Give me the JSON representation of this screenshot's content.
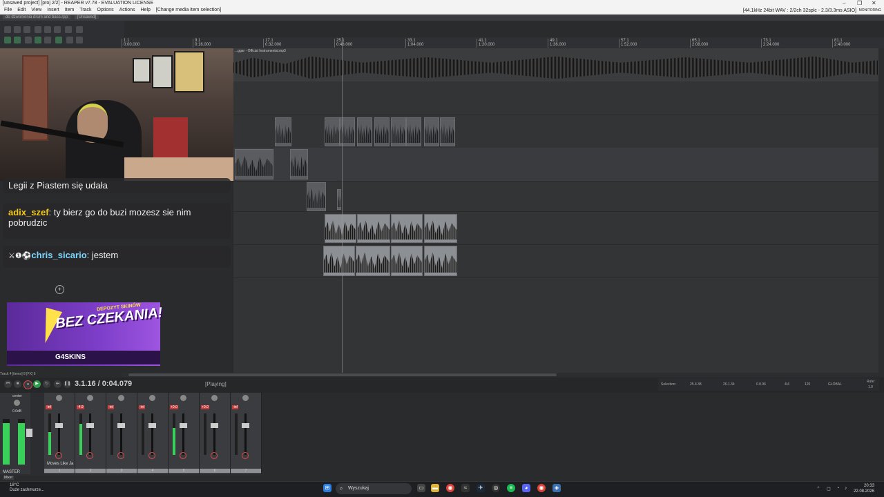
{
  "window": {
    "title": "[unsaved project] [proj 2/2] - REAPER v7.78 - EVALUATION LICENSE",
    "minimize": "–",
    "maximize": "❐",
    "close": "✕"
  },
  "menu": {
    "items": [
      "File",
      "Edit",
      "View",
      "Insert",
      "Item",
      "Track",
      "Options",
      "Actions",
      "Help"
    ],
    "status": "[Change media item selection]",
    "format_info": "[44.1kHz 24bit WAV : 2/2ch 32splc - 2.3/3.3ms ASIO]",
    "monitoring": "MONITORING"
  },
  "tabs": {
    "tab1": "do dzwonienia drum and bass.rpp",
    "tab2": "[Unsaved]"
  },
  "ruler": {
    "ticks": [
      {
        "bar": "1.1",
        "time": "0:00.000"
      },
      {
        "bar": "9.1",
        "time": "0:16.000"
      },
      {
        "bar": "17.1",
        "time": "0:32.000"
      },
      {
        "bar": "25.1",
        "time": "0:48.000"
      },
      {
        "bar": "33.1",
        "time": "1:04.000"
      },
      {
        "bar": "41.1",
        "time": "1:20.000"
      },
      {
        "bar": "49.1",
        "time": "1:36.000"
      },
      {
        "bar": "57.1",
        "time": "1:52.000"
      },
      {
        "bar": "65.1",
        "time": "2:08.000"
      },
      {
        "bar": "73.1",
        "time": "2:24.000"
      },
      {
        "bar": "81.1",
        "time": "2:40.000"
      }
    ]
  },
  "arrange": {
    "main_item_label": "...ggar - Official Instrumental.mp3"
  },
  "chat": {
    "msg1": "Legii z Piastem się udała",
    "msg2_user": "adix_szef",
    "msg2_text": ": ty bierz go do buzi mozesz sie nim pobrudzic",
    "msg3_badges": "⚔❶⚽",
    "msg3_user": "chris_sicario",
    "msg3_text": ": jestem"
  },
  "promo": {
    "small": "DEPOZYT SKINÓW",
    "big": "BEZ CZEKANIA!",
    "brand": "G4SKINS"
  },
  "transport": {
    "track_info": "Track 4 [items] 8 [FX] 6",
    "time": "3.1.16 / 0:04.079",
    "state": "[Playing]",
    "selection_label": "Selection:",
    "sel_start": "25.4.38",
    "sel_end": "26.1.34",
    "sel_len": "0.0.96",
    "timesig": "4/4",
    "bpm": "120",
    "global": "GLOBAL",
    "rate_label": "Rate:",
    "rate": "1.0"
  },
  "mixer": {
    "master_label": "MASTER",
    "mixer_tab": "Mixer",
    "master_center": "center",
    "master_peak": "0.0dB",
    "track_name": "Moves Like Ja",
    "strips": [
      {
        "num": "1",
        "peak": "-inf",
        "level": 0.55
      },
      {
        "num": "2",
        "peak": "-4.9",
        "level": 0.75
      },
      {
        "num": "3",
        "peak": "-inf",
        "level": 0
      },
      {
        "num": "4",
        "peak": "-inf",
        "level": 0
      },
      {
        "num": "5",
        "peak": "+0.0",
        "level": 0.65
      },
      {
        "num": "6",
        "peak": "+0.0",
        "level": 0
      },
      {
        "num": "7",
        "peak": "-inf",
        "level": 0
      }
    ]
  },
  "taskbar": {
    "temp": "18°C",
    "weather": "Duże zachmurze...",
    "search": "Wyszukaj",
    "time": "20:33",
    "date": "22.08.2026"
  }
}
